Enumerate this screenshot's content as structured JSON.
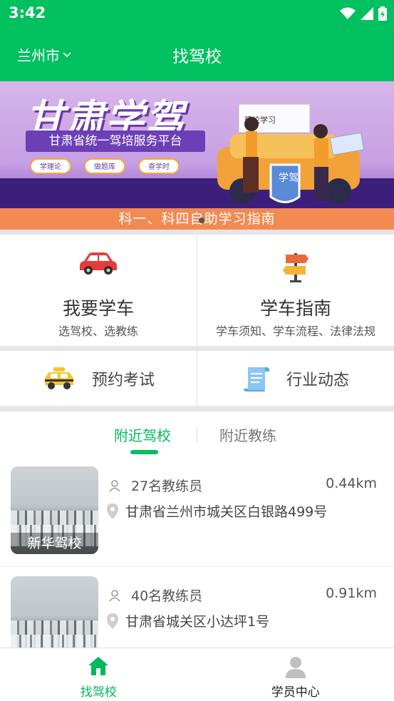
{
  "status": {
    "time": "3:42"
  },
  "appbar": {
    "city": "兰州市",
    "title": "找驾校"
  },
  "banner": {
    "headline": "甘肃学驾",
    "platform": "甘肃省统一驾培服务平台",
    "pills": [
      "学理论",
      "做题库",
      "查学时"
    ],
    "strip": "科一、科四自助学习指南",
    "shield_text": "学驾",
    "board_text": "理论学习"
  },
  "features": [
    {
      "label": "我要学车",
      "sub": "选驾校、选教练",
      "icon": "car-icon"
    },
    {
      "label": "学车指南",
      "sub": "学车须知、学车流程、法律法规",
      "icon": "signpost-icon"
    }
  ],
  "quick": [
    {
      "label": "预约考试",
      "icon": "taxi-icon"
    },
    {
      "label": "行业动态",
      "icon": "scroll-icon"
    }
  ],
  "tabs": {
    "nearby_schools": "附近驾校",
    "nearby_coaches": "附近教练"
  },
  "schools": [
    {
      "name": "新华驾校",
      "coaches": "27名教练员",
      "distance": "0.44km",
      "address": "甘肃省兰州市城关区白银路499号"
    },
    {
      "name": "",
      "coaches": "40名教练员",
      "distance": "0.91km",
      "address": "甘肃省城关区小达坪1号"
    }
  ],
  "nav": {
    "find_school": "找驾校",
    "student_center": "学员中心"
  },
  "colors": {
    "brand": "#00c05f",
    "accent_text": "#00b95a",
    "banner_strip": "#f28a52"
  }
}
